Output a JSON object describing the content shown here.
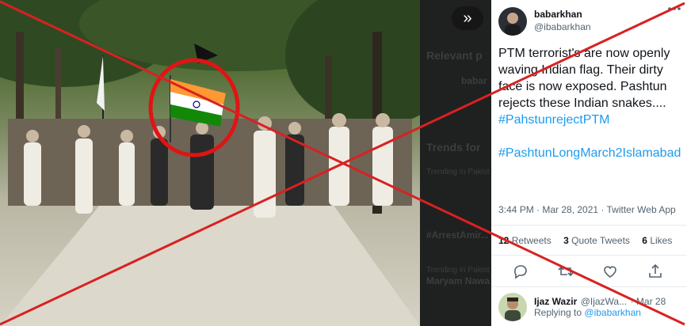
{
  "colors": {
    "accent": "#1d9bf0",
    "cross": "#d92121",
    "text": "#0f1419",
    "muted": "#536471"
  },
  "photo": {
    "description_icon": "march-photo",
    "flag_colors": [
      "#ff9933",
      "#ffffff",
      "#138808"
    ]
  },
  "media_viewer": {
    "expand_icon": "chevrons-right-icon",
    "expand_glyph": "»",
    "ghost_labels": [
      "Relevant p",
      "Trends for",
      "babar",
      "Trending in Pakist",
      "#ArrestAmir...",
      "Maryam Nawa",
      "Trending in Pakist"
    ]
  },
  "tweet": {
    "author_name": "babarkhan",
    "author_handle": "@ibabarkhan",
    "more_icon": "more-dots-icon",
    "body": "PTM terrorist's are now openly waving Indian flag. Their dirty face is now exposed. Pashtun rejects these Indian snakes....",
    "hashtag1": "#PahstunrejectPTM",
    "hashtag2": "#PashtunLongMarch2Islamabad",
    "meta": "3:44 PM · Mar 28, 2021 · Twitter Web App",
    "retweets_count": "12",
    "retweets_label": "Retweets",
    "quotes_count": "3",
    "quotes_label": "Quote Tweets",
    "likes_count": "6",
    "likes_label": "Likes"
  },
  "actions": [
    "reply-icon",
    "retweet-icon",
    "like-icon",
    "share-icon"
  ],
  "reply": {
    "author_name": "Ijaz Wazir",
    "author_handle": "@IjazWa...",
    "date": "· Mar 28",
    "replying_prefix": "Replying to",
    "replying_to": "@ibabarkhan"
  }
}
